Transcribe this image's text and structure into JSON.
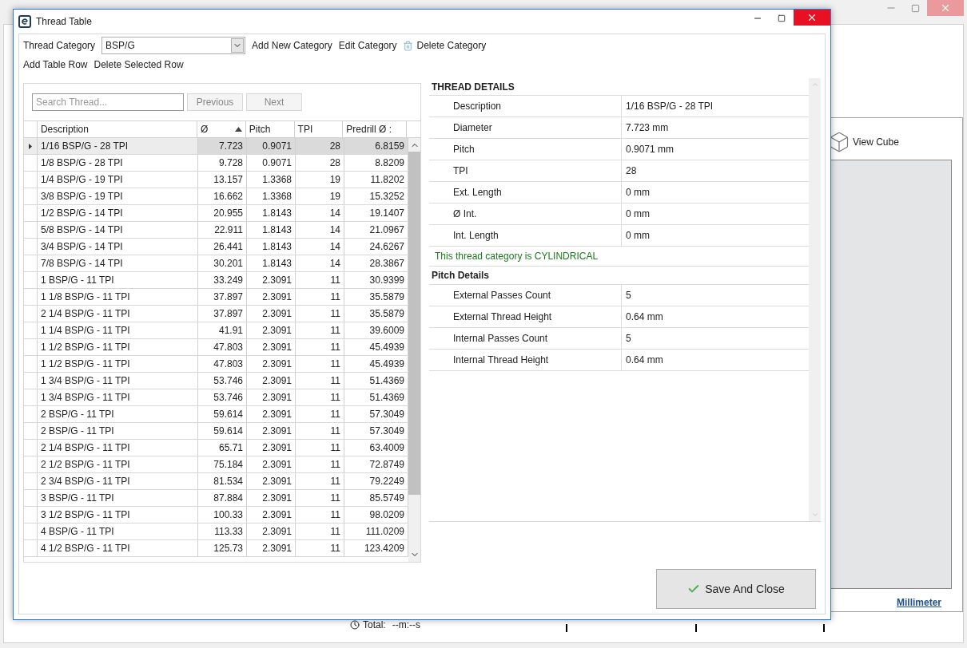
{
  "background_window": {
    "view_cube_label": "View Cube",
    "unit_link": "Millimeter",
    "total_label": "Total:",
    "total_value": "--m:--s"
  },
  "dialog": {
    "title": "Thread Table"
  },
  "toolbar": {
    "category_label": "Thread Category",
    "category_value": "BSP/G",
    "actions": [
      "Add New Category",
      "Edit Category",
      "Delete Category"
    ],
    "row_actions": [
      "Add Table Row",
      "Delete Selected Row"
    ]
  },
  "search": {
    "placeholder": "Search Thread...",
    "buttons": [
      {
        "label": "Previous",
        "disabled": true
      },
      {
        "label": "Next",
        "disabled": true
      }
    ]
  },
  "table": {
    "columns": [
      "Description",
      "Ø",
      "Pitch",
      "TPI",
      "Predrill Ø :"
    ],
    "rows": [
      {
        "cells": [
          "1/16 BSP/G - 28 TPI",
          "7.723",
          "0.9071",
          "28",
          "6.8159"
        ],
        "selected": true
      },
      {
        "cells": [
          "1/8 BSP/G - 28 TPI",
          "9.728",
          "0.9071",
          "28",
          "8.8209"
        ],
        "selected": false
      },
      {
        "cells": [
          "1/4 BSP/G - 19 TPI",
          "13.157",
          "1.3368",
          "19",
          "11.8202"
        ],
        "selected": false
      },
      {
        "cells": [
          "3/8 BSP/G - 19 TPI",
          "16.662",
          "1.3368",
          "19",
          "15.3252"
        ],
        "selected": false
      },
      {
        "cells": [
          "1/2 BSP/G - 14 TPI",
          "20.955",
          "1.8143",
          "14",
          "19.1407"
        ],
        "selected": false
      },
      {
        "cells": [
          "5/8 BSP/G - 14 TPI",
          "22.911",
          "1.8143",
          "14",
          "21.0967"
        ],
        "selected": false
      },
      {
        "cells": [
          "3/4 BSP/G - 14 TPI",
          "26.441",
          "1.8143",
          "14",
          "24.6267"
        ],
        "selected": false
      },
      {
        "cells": [
          "7/8 BSP/G - 14 TPI",
          "30.201",
          "1.8143",
          "14",
          "28.3867"
        ],
        "selected": false
      },
      {
        "cells": [
          "1 BSP/G - 11 TPI",
          "33.249",
          "2.3091",
          "11",
          "30.9399"
        ],
        "selected": false
      },
      {
        "cells": [
          "1 1/8 BSP/G - 11 TPI",
          "37.897",
          "2.3091",
          "11",
          "35.5879"
        ],
        "selected": false
      },
      {
        "cells": [
          "2 1/4 BSP/G - 11 TPI",
          "37.897",
          "2.3091",
          "11",
          "35.5879"
        ],
        "selected": false
      },
      {
        "cells": [
          "1 1/4 BSP/G - 11 TPI",
          "41.91",
          "2.3091",
          "11",
          "39.6009"
        ],
        "selected": false
      },
      {
        "cells": [
          "1 1/2 BSP/G - 11 TPI",
          "47.803",
          "2.3091",
          "11",
          "45.4939"
        ],
        "selected": false
      },
      {
        "cells": [
          "1 1/2 BSP/G - 11 TPI",
          "47.803",
          "2.3091",
          "11",
          "45.4939"
        ],
        "selected": false
      },
      {
        "cells": [
          "1 3/4 BSP/G - 11 TPI",
          "53.746",
          "2.3091",
          "11",
          "51.4369"
        ],
        "selected": false
      },
      {
        "cells": [
          "1 3/4 BSP/G - 11 TPI",
          "53.746",
          "2.3091",
          "11",
          "51.4369"
        ],
        "selected": false
      },
      {
        "cells": [
          "2 BSP/G - 11 TPI",
          "59.614",
          "2.3091",
          "11",
          "57.3049"
        ],
        "selected": false
      },
      {
        "cells": [
          "2 BSP/G - 11 TPI",
          "59.614",
          "2.3091",
          "11",
          "57.3049"
        ],
        "selected": false
      },
      {
        "cells": [
          "2 1/4 BSP/G - 11 TPI",
          "65.71",
          "2.3091",
          "11",
          "63.4009"
        ],
        "selected": false
      },
      {
        "cells": [
          "2 1/2 BSP/G - 11 TPI",
          "75.184",
          "2.3091",
          "11",
          "72.8749"
        ],
        "selected": false
      },
      {
        "cells": [
          "2 3/4 BSP/G - 11 TPI",
          "81.534",
          "2.3091",
          "11",
          "79.2249"
        ],
        "selected": false
      },
      {
        "cells": [
          "3 BSP/G - 11 TPI",
          "87.884",
          "2.3091",
          "11",
          "85.5749"
        ],
        "selected": false
      },
      {
        "cells": [
          "3 1/2 BSP/G - 11 TPI",
          "100.33",
          "2.3091",
          "11",
          "98.0209"
        ],
        "selected": false
      },
      {
        "cells": [
          "4 BSP/G - 11 TPI",
          "113.33",
          "2.3091",
          "11",
          "111.0209"
        ],
        "selected": false
      },
      {
        "cells": [
          "4 1/2 BSP/G - 11 TPI",
          "125.73",
          "2.3091",
          "11",
          "123.4209"
        ],
        "selected": false
      }
    ]
  },
  "details": {
    "title": "THREAD DETAILS",
    "properties": [
      {
        "label": "Description",
        "value": "1/16 BSP/G - 28 TPI"
      },
      {
        "label": "Diameter",
        "value": "7.723 mm"
      },
      {
        "label": "Pitch",
        "value": "0.9071 mm"
      },
      {
        "label": "TPI",
        "value": "28"
      },
      {
        "label": "Ext. Length",
        "value": "0 mm"
      },
      {
        "label": "Ø Int.",
        "value": "0 mm"
      },
      {
        "label": "Int. Length",
        "value": "0 mm"
      }
    ],
    "category_note": "This thread category is CYLINDRICAL",
    "pitch_title": "Pitch Details",
    "pitch_properties": [
      {
        "label": "External Passes Count",
        "value": "5"
      },
      {
        "label": "External Thread Height",
        "value": "0.64 mm"
      },
      {
        "label": "Internal Passes Count",
        "value": "5"
      },
      {
        "label": "Internal Thread Height",
        "value": "0.64 mm"
      }
    ]
  },
  "save_button": "Save And Close"
}
